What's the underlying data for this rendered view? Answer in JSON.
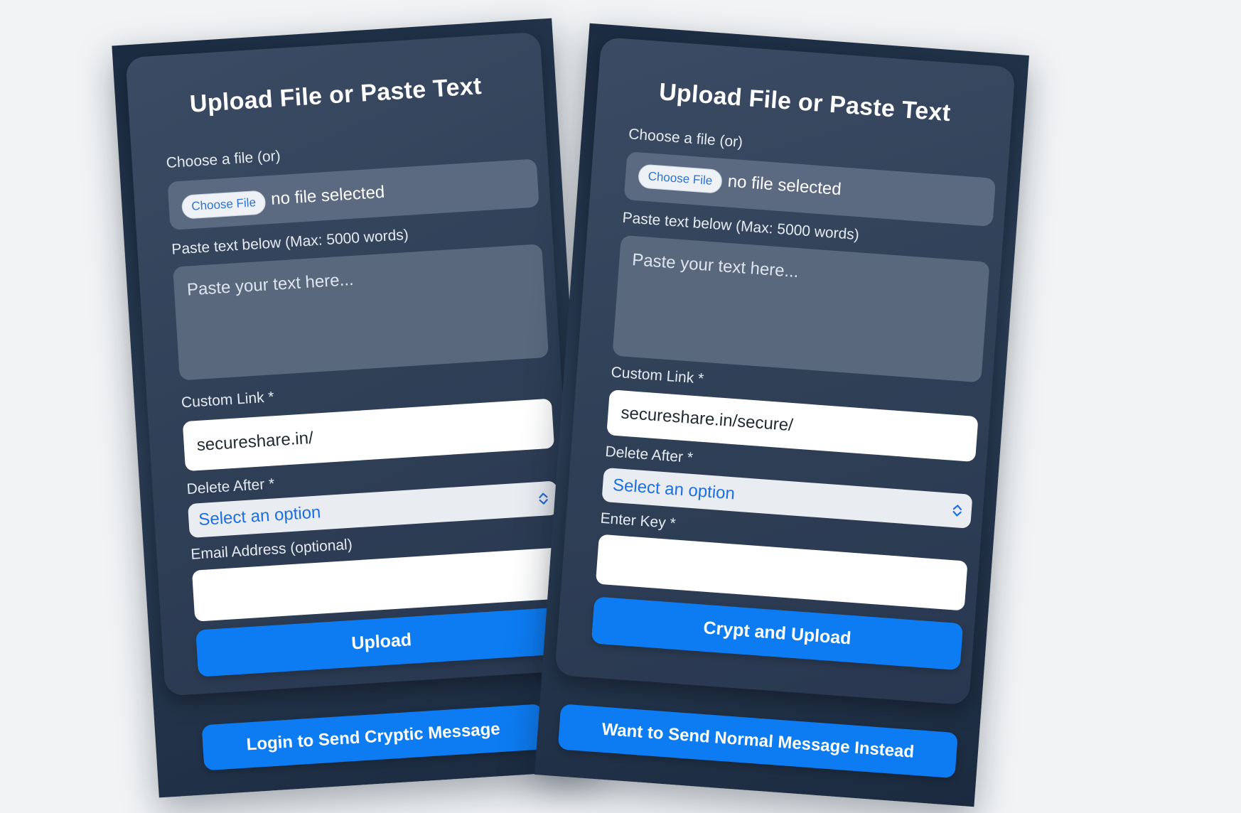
{
  "left_panel": {
    "title": "Upload File or Paste Text",
    "file_label": "Choose a file (or)",
    "choose_file_button": "Choose File",
    "file_status": "no file selected",
    "paste_label": "Paste text below (Max: 5000 words)",
    "textarea_placeholder": "Paste your text here...",
    "custom_link_label": "Custom Link *",
    "custom_link_value": "secureshare.in/",
    "delete_after_label": "Delete After *",
    "delete_after_value": "Select an option",
    "email_label": "Email Address (optional)",
    "email_value": "",
    "submit_button": "Upload",
    "footer_button": "Login to Send Cryptic Message"
  },
  "right_panel": {
    "title": "Upload File or Paste Text",
    "file_label": "Choose a file (or)",
    "choose_file_button": "Choose File",
    "file_status": "no file selected",
    "paste_label": "Paste text below (Max: 5000 words)",
    "textarea_placeholder": "Paste your text here...",
    "custom_link_label": "Custom Link *",
    "custom_link_value": "secureshare.in/secure/",
    "delete_after_label": "Delete After *",
    "delete_after_value": "Select an option",
    "key_label": "Enter Key *",
    "key_value": "",
    "submit_button": "Crypt and Upload",
    "footer_button": "Want to Send Normal Message Instead"
  },
  "colors": {
    "page_background": "#f1f3f5",
    "panel_background": "#1c2c42",
    "card_background": "#34455d",
    "accent_blue": "#0d7cf2",
    "select_text": "#1b6fe0"
  },
  "icons": {
    "select_chevron": "chevron-up-down-icon"
  }
}
